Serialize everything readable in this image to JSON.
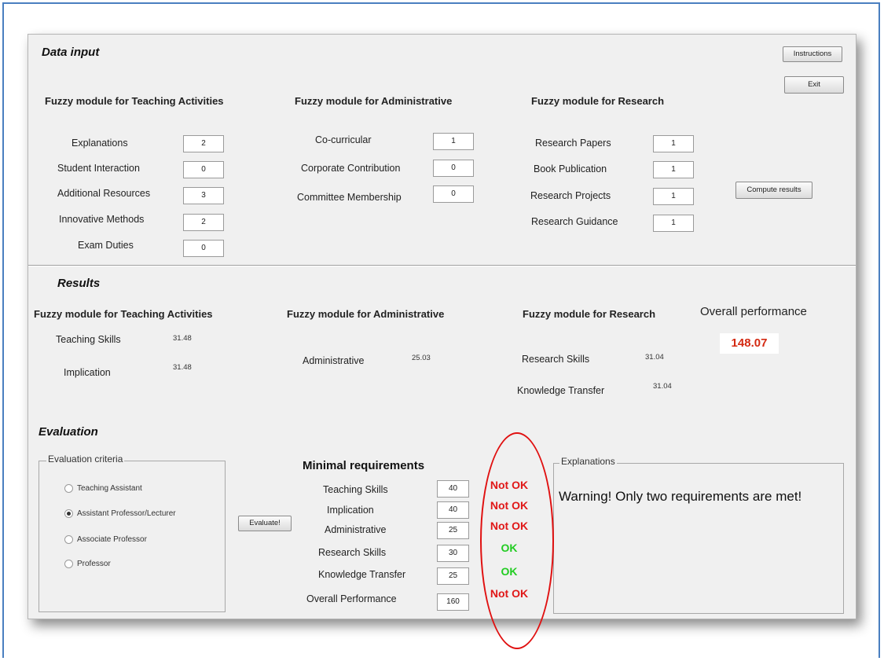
{
  "data_input": {
    "title": "Data input",
    "instructions_button": "Instructions",
    "exit_button": "Exit",
    "compute_button": "Compute results",
    "teaching": {
      "title": "Fuzzy module for Teaching Activities",
      "fields": [
        {
          "label": "Explanations",
          "value": "2"
        },
        {
          "label": "Student Interaction",
          "value": "0"
        },
        {
          "label": "Additional Resources",
          "value": "3"
        },
        {
          "label": "Innovative Methods",
          "value": "2"
        },
        {
          "label": "Exam Duties",
          "value": "0"
        }
      ]
    },
    "administrative": {
      "title": "Fuzzy module for Administrative",
      "fields": [
        {
          "label": "Co-curricular",
          "value": "1"
        },
        {
          "label": "Corporate Contribution",
          "value": "0"
        },
        {
          "label": "Committee Membership",
          "value": "0"
        }
      ]
    },
    "research": {
      "title": "Fuzzy module for Research",
      "fields": [
        {
          "label": "Research Papers",
          "value": "1"
        },
        {
          "label": "Book Publication",
          "value": "1"
        },
        {
          "label": "Research Projects",
          "value": "1"
        },
        {
          "label": "Research Guidance",
          "value": "1"
        }
      ]
    }
  },
  "results": {
    "title": "Results",
    "teaching": {
      "title": "Fuzzy module for Teaching Activities",
      "rows": [
        {
          "label": "Teaching Skills",
          "value": "31.48"
        },
        {
          "label": "Implication",
          "value": "31.48"
        }
      ]
    },
    "administrative": {
      "title": "Fuzzy module for Administrative",
      "rows": [
        {
          "label": "Administrative",
          "value": "25.03"
        }
      ]
    },
    "research": {
      "title": "Fuzzy module for Research",
      "rows": [
        {
          "label": "Research Skills",
          "value": "31.04"
        },
        {
          "label": "Knowledge Transfer",
          "value": "31.04"
        }
      ]
    },
    "overall": {
      "label": "Overall performance",
      "value": "148.07"
    }
  },
  "evaluation": {
    "title": "Evaluation",
    "criteria": {
      "legend": "Evaluation criteria",
      "options": [
        {
          "label": "Teaching Assistant",
          "selected": false
        },
        {
          "label": "Assistant Professor/Lecturer",
          "selected": true
        },
        {
          "label": "Associate Professor",
          "selected": false
        },
        {
          "label": "Professor",
          "selected": false
        }
      ]
    },
    "evaluate_button": "Evaluate!",
    "minimal": {
      "title": "Minimal requirements",
      "rows": [
        {
          "label": "Teaching Skills",
          "value": "40",
          "status": "Not OK"
        },
        {
          "label": "Implication",
          "value": "40",
          "status": "Not OK"
        },
        {
          "label": "Administrative",
          "value": "25",
          "status": "Not OK"
        },
        {
          "label": "Research Skills",
          "value": "30",
          "status": "OK"
        },
        {
          "label": "Knowledge Transfer",
          "value": "25",
          "status": "OK"
        },
        {
          "label": "Overall Performance",
          "value": "160",
          "status": "Not OK"
        }
      ]
    },
    "explanations": {
      "legend": "Explanations",
      "text": "Warning! Only two requirements are met!"
    }
  },
  "colors": {
    "not_ok": "#e01818",
    "ok": "#22cc22",
    "overall_value": "#d42a12",
    "annotation_ellipse": "#e01010",
    "frame_border": "#4a7fc0"
  }
}
